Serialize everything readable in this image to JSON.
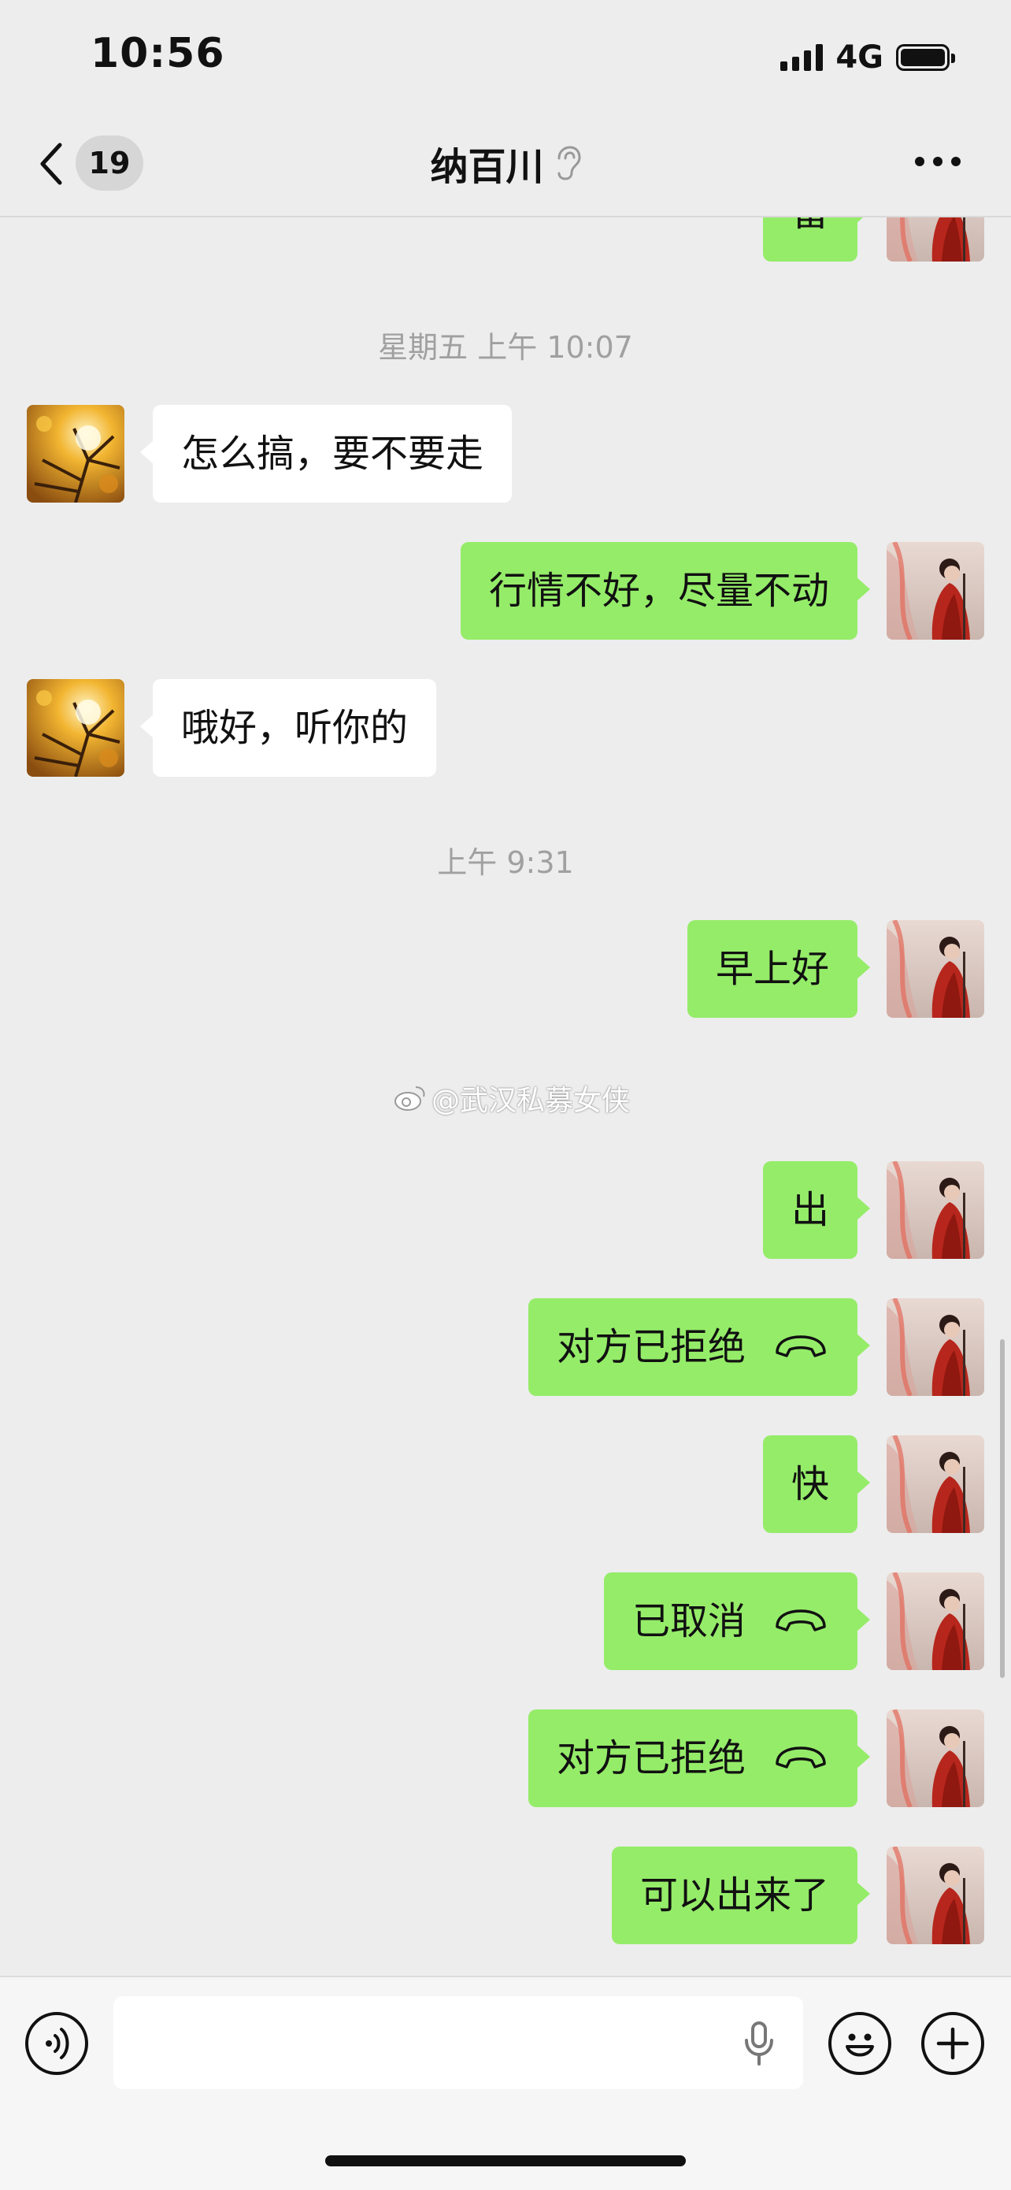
{
  "status_bar": {
    "time": "10:56",
    "network": "4G"
  },
  "header": {
    "back_count": "19",
    "title": "纳百川"
  },
  "messages": {
    "m0": {
      "text": "留"
    },
    "t1": {
      "text": "星期五 上午 10:07"
    },
    "m1": {
      "text": "怎么搞，要不要走"
    },
    "m2": {
      "text": "行情不好，尽量不动"
    },
    "m3": {
      "text": "哦好，听你的"
    },
    "t2": {
      "text": "上午 9:31"
    },
    "m4": {
      "text": "早上好"
    },
    "m5": {
      "text": "出"
    },
    "m6": {
      "text": "对方已拒绝"
    },
    "m7": {
      "text": "快"
    },
    "m8": {
      "text": "已取消"
    },
    "m9": {
      "text": "对方已拒绝"
    },
    "m10": {
      "text": "可以出来了"
    }
  },
  "watermark": {
    "text": "@武汉私募女侠"
  },
  "colors": {
    "bubble_self": "#95ec69",
    "bubble_other": "#ffffff",
    "background": "#ededed"
  },
  "icons": [
    "back-chevron-icon",
    "ear-icon",
    "more-icon",
    "voice-icon",
    "mic-icon",
    "emoji-icon",
    "plus-icon",
    "call-hangup-icon"
  ]
}
